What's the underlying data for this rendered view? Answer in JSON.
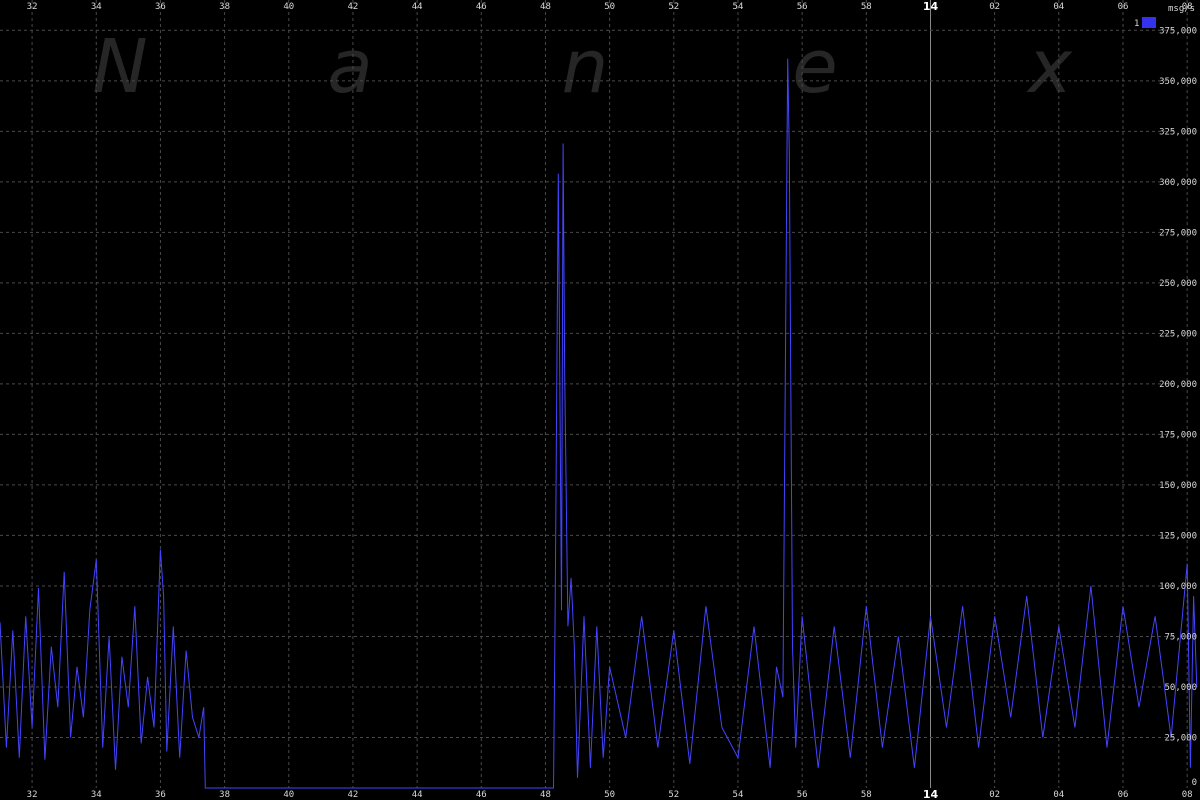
{
  "watermark": [
    "N",
    "a",
    "n",
    "e",
    "x"
  ],
  "chart_data": {
    "type": "line",
    "unit_label": "msg/s",
    "legend": [
      {
        "label": "1",
        "color": "#3333ee"
      }
    ],
    "series_color": "#4444ff",
    "grid": true,
    "legend_position": "top-right",
    "ylim": [
      0,
      390000
    ],
    "xlim": [
      31.0,
      68.4
    ],
    "y_ticks": [
      {
        "value": 0,
        "label": "0"
      },
      {
        "value": 25000,
        "label": "25,000"
      },
      {
        "value": 50000,
        "label": "50,000"
      },
      {
        "value": 75000,
        "label": "75,000"
      },
      {
        "value": 100000,
        "label": "100,000"
      },
      {
        "value": 125000,
        "label": "125,000"
      },
      {
        "value": 150000,
        "label": "150,000"
      },
      {
        "value": 175000,
        "label": "175,000"
      },
      {
        "value": 200000,
        "label": "200,000"
      },
      {
        "value": 225000,
        "label": "225,000"
      },
      {
        "value": 250000,
        "label": "250,000"
      },
      {
        "value": 275000,
        "label": "275,000"
      },
      {
        "value": 300000,
        "label": "300,000"
      },
      {
        "value": 325000,
        "label": "325,000"
      },
      {
        "value": 350000,
        "label": "350,000"
      },
      {
        "value": 375000,
        "label": "375,000"
      }
    ],
    "x_ticks": [
      {
        "value": 32,
        "label": "32",
        "bold": false
      },
      {
        "value": 34,
        "label": "34",
        "bold": false
      },
      {
        "value": 36,
        "label": "36",
        "bold": false
      },
      {
        "value": 38,
        "label": "38",
        "bold": false
      },
      {
        "value": 40,
        "label": "40",
        "bold": false
      },
      {
        "value": 42,
        "label": "42",
        "bold": false
      },
      {
        "value": 44,
        "label": "44",
        "bold": false
      },
      {
        "value": 46,
        "label": "46",
        "bold": false
      },
      {
        "value": 48,
        "label": "48",
        "bold": false
      },
      {
        "value": 50,
        "label": "50",
        "bold": false
      },
      {
        "value": 52,
        "label": "52",
        "bold": false
      },
      {
        "value": 54,
        "label": "54",
        "bold": false
      },
      {
        "value": 56,
        "label": "56",
        "bold": false
      },
      {
        "value": 58,
        "label": "58",
        "bold": false
      },
      {
        "value": 60,
        "label": "14",
        "bold": true
      },
      {
        "value": 62,
        "label": "02",
        "bold": false
      },
      {
        "value": 64,
        "label": "04",
        "bold": false
      },
      {
        "value": 66,
        "label": "06",
        "bold": false
      },
      {
        "value": 68,
        "label": "08",
        "bold": false
      }
    ],
    "series": [
      {
        "x": [
          31.0,
          31.2,
          31.4,
          31.6,
          31.8,
          32.0,
          32.2,
          32.4,
          32.6,
          32.8,
          33.0,
          33.2,
          33.4,
          33.6,
          33.8,
          34.0,
          34.2,
          34.4,
          34.6,
          34.8,
          35.0,
          35.2,
          35.4,
          35.6,
          35.8,
          36.0,
          36.1,
          36.2,
          36.4,
          36.6,
          36.8,
          37.0,
          37.2,
          37.35,
          37.4,
          48.25,
          48.3,
          48.4,
          48.5,
          48.55,
          48.6,
          48.7,
          48.8,
          48.9,
          49.0,
          49.2,
          49.4,
          49.6,
          49.8,
          50.0,
          50.5,
          51.0,
          51.5,
          52.0,
          52.5,
          53.0,
          53.5,
          54.0,
          54.5,
          55.0,
          55.2,
          55.4,
          55.55,
          55.6,
          55.7,
          55.8,
          56.0,
          56.5,
          57.0,
          57.5,
          58.0,
          58.5,
          59.0,
          59.5,
          60.0,
          60.5,
          61.0,
          61.5,
          62.0,
          62.5,
          63.0,
          63.5,
          64.0,
          64.5,
          65.0,
          65.5,
          66.0,
          66.5,
          67.0,
          67.5,
          68.0,
          68.1,
          68.2,
          68.3
        ],
        "y": [
          82000,
          20000,
          78000,
          15000,
          85000,
          30000,
          99000,
          14000,
          70000,
          40000,
          107000,
          25000,
          60000,
          35000,
          88000,
          113000,
          20000,
          75000,
          9000,
          65000,
          40000,
          90000,
          22000,
          55000,
          30000,
          118000,
          95000,
          18000,
          80000,
          15000,
          68000,
          35000,
          25000,
          40000,
          0,
          0,
          85000,
          304000,
          88000,
          319000,
          205000,
          80000,
          104000,
          70000,
          5000,
          85000,
          10000,
          80000,
          15000,
          60000,
          25000,
          85000,
          20000,
          78000,
          12000,
          90000,
          30000,
          15000,
          80000,
          10000,
          60000,
          45000,
          361000,
          315000,
          70000,
          20000,
          85000,
          10000,
          80000,
          15000,
          90000,
          20000,
          75000,
          10000,
          85000,
          30000,
          90000,
          20000,
          85000,
          35000,
          95000,
          25000,
          80000,
          30000,
          100000,
          20000,
          90000,
          40000,
          85000,
          25000,
          111000,
          10000,
          95000,
          50000
        ]
      }
    ]
  }
}
